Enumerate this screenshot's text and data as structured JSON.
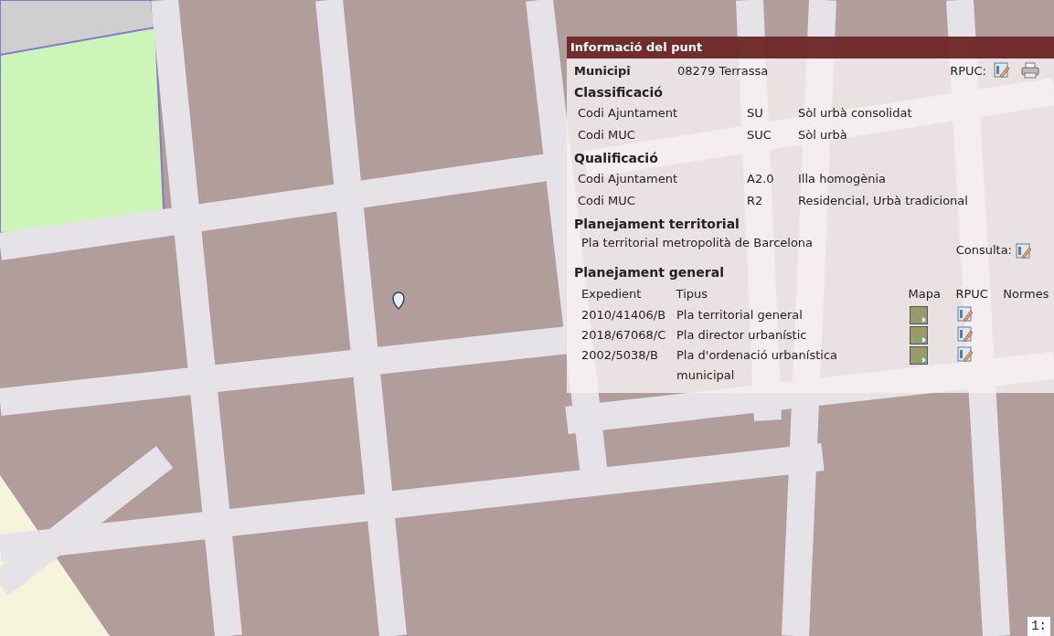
{
  "map": {
    "scale": "1:"
  },
  "panel": {
    "title": "Informació del punt",
    "municipi": {
      "label": "Municipi",
      "value": "08279 Terrassa",
      "rpuc_label": "RPUC:"
    },
    "sections": [
      {
        "title": "Classificació",
        "rows": [
          {
            "label": "Codi Ajuntament",
            "code": "SU",
            "description": "Sòl urbà consolidat"
          },
          {
            "label": "Codi MUC",
            "code": "SUC",
            "description": "Sòl urbà"
          }
        ]
      },
      {
        "title": "Qualificació",
        "rows": [
          {
            "label": "Codi Ajuntament",
            "code": "A2.0",
            "description": "Illa homogènia"
          },
          {
            "label": "Codi MUC",
            "code": "R2",
            "description": "Residencial, Urbà tradicional"
          }
        ]
      }
    ],
    "territorial": {
      "title": "Planejament territorial",
      "name": "Pla territorial metropolità de Barcelona",
      "consulta_label": "Consulta:"
    },
    "general": {
      "title": "Planejament general",
      "columns": [
        "Expedient",
        "Tipus",
        "Mapa",
        "RPUC",
        "Normes"
      ],
      "rows": [
        {
          "expedient": "2010/41406/B",
          "tipus": "Pla territorial general"
        },
        {
          "expedient": "2018/67068/C",
          "tipus": "Pla director urbanístic"
        },
        {
          "expedient": "2002/5038/B",
          "tipus": "Pla d'ordenació urbanística municipal"
        }
      ]
    }
  }
}
